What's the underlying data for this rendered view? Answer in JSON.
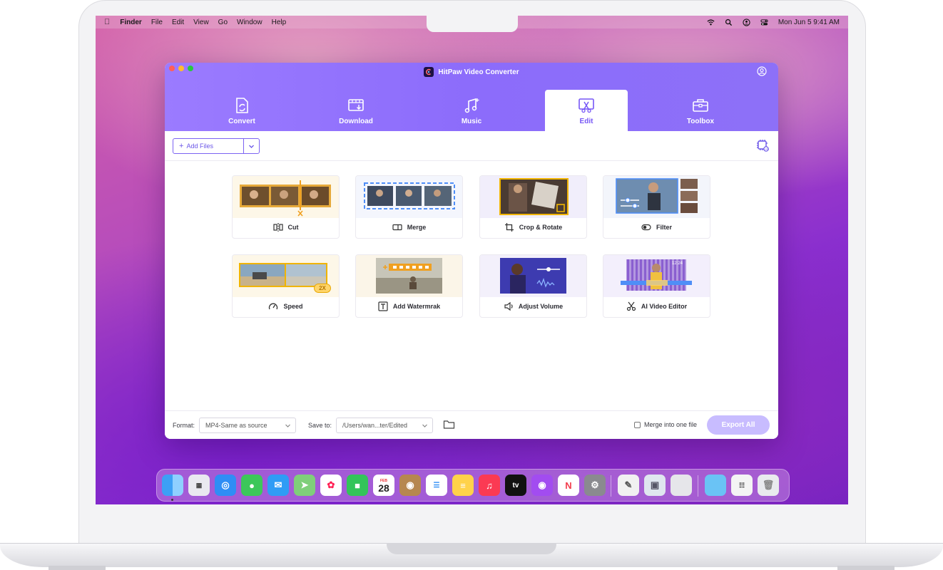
{
  "menubar": {
    "app_name": "Finder",
    "items": [
      "File",
      "Edit",
      "View",
      "Go",
      "Window",
      "Help"
    ],
    "clock": "Mon Jun 5  9:41 AM"
  },
  "app": {
    "title": "HitPaw Video Converter",
    "tabs": [
      {
        "label": "Convert",
        "icon": "convert-icon"
      },
      {
        "label": "Download",
        "icon": "download-icon"
      },
      {
        "label": "Music",
        "icon": "music-icon"
      },
      {
        "label": "Edit",
        "icon": "edit-icon",
        "active": true
      },
      {
        "label": "Toolbox",
        "icon": "toolbox-icon"
      }
    ],
    "add_files_label": "Add Files",
    "tools": [
      {
        "label": "Cut",
        "icon": "cut-icon"
      },
      {
        "label": "Merge",
        "icon": "merge-icon"
      },
      {
        "label": "Crop & Rotate",
        "icon": "crop-icon"
      },
      {
        "label": "Filter",
        "icon": "filter-icon"
      },
      {
        "label": "Speed",
        "icon": "speed-icon",
        "badge": "2X"
      },
      {
        "label": "Add Watermrak",
        "icon": "text-icon"
      },
      {
        "label": "Adjust Volume",
        "icon": "volume-icon"
      },
      {
        "label": "AI Video Editor",
        "icon": "scissors-icon",
        "time": "12:24"
      }
    ],
    "bottom": {
      "format_label": "Format:",
      "format_value": "MP4-Same as source",
      "save_label": "Save to:",
      "save_value": "/Users/wan...ter/Edited",
      "merge_label": "Merge into one file",
      "export_label": "Export All"
    }
  },
  "dock": {
    "calendar_day": "28",
    "calendar_month": "FEB",
    "tv_label": "tv"
  },
  "colors": {
    "accent": "#7757f6",
    "header": "#8c6cfb",
    "export_disabled": "#c8bcff"
  }
}
